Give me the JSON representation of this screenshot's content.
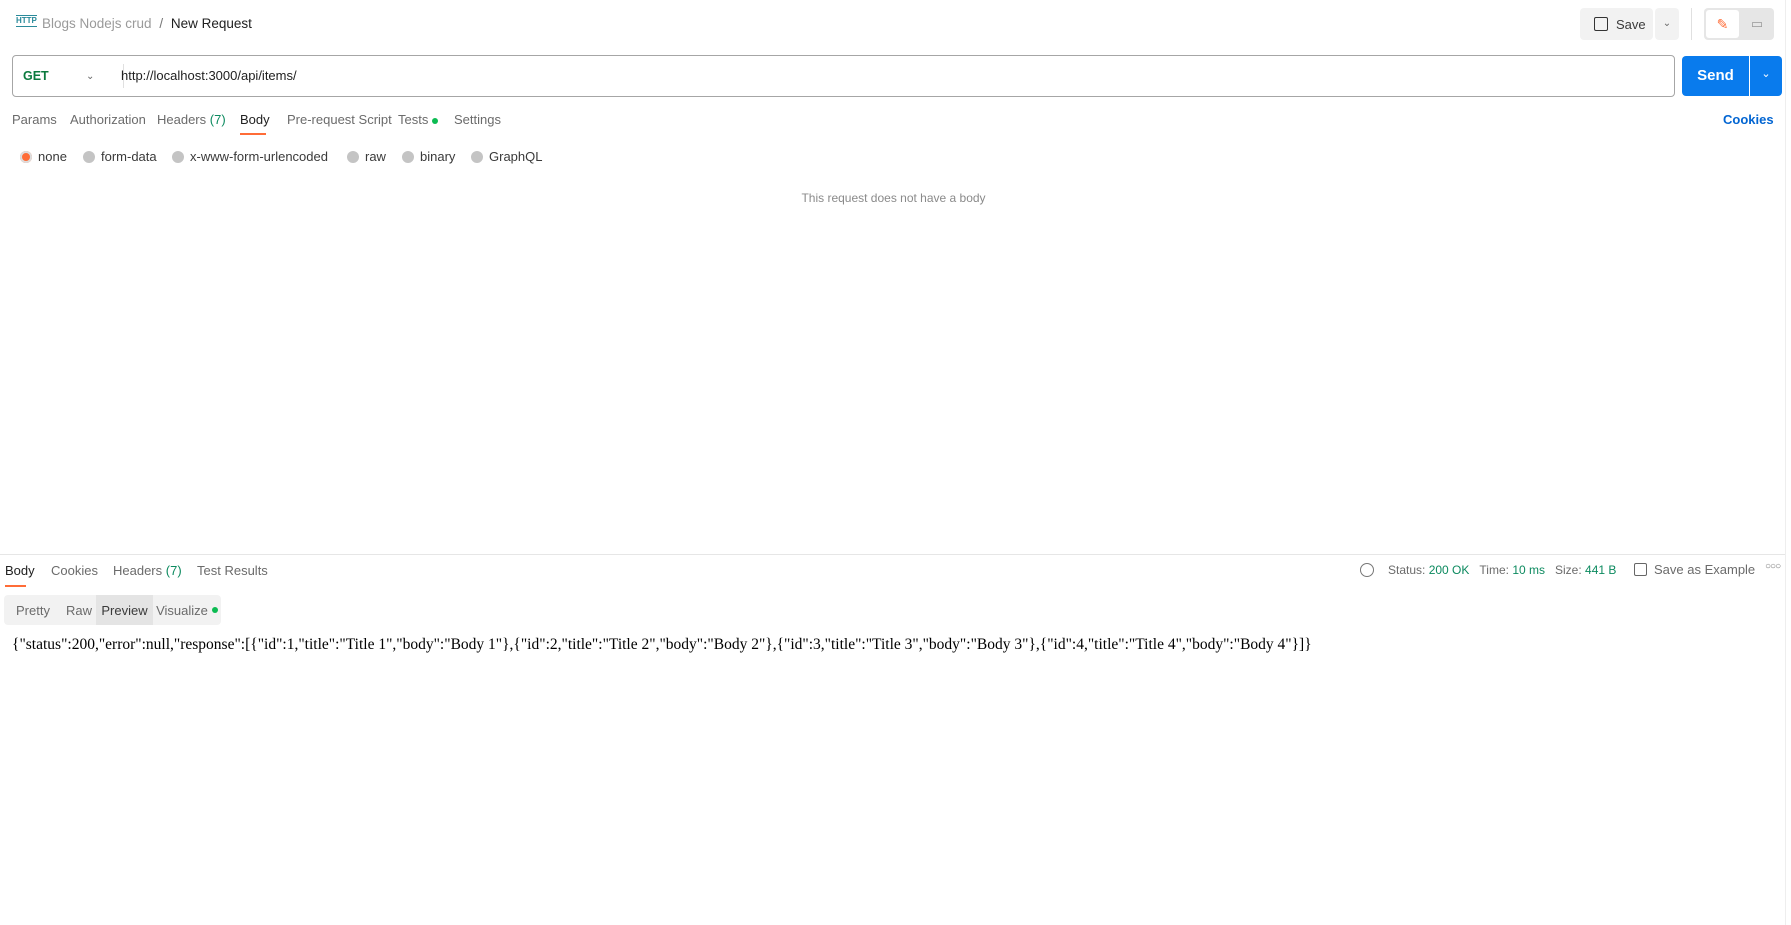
{
  "header": {
    "icon": "http-icon",
    "collection": "Blogs Nodejs crud",
    "separator": "/",
    "request_name": "New Request",
    "save_label": "Save"
  },
  "request": {
    "method": "GET",
    "url": "http://localhost:3000/api/items/",
    "send_label": "Send"
  },
  "tabs": [
    {
      "label": "Params"
    },
    {
      "label": "Authorization"
    },
    {
      "label": "Headers",
      "count": "(7)"
    },
    {
      "label": "Body",
      "active": true
    },
    {
      "label": "Pre-request Script"
    },
    {
      "label": "Tests"
    },
    {
      "label": "Settings"
    }
  ],
  "cookies_label": "Cookies",
  "body_types": [
    {
      "label": "none",
      "selected": true
    },
    {
      "label": "form-data"
    },
    {
      "label": "x-www-form-urlencoded"
    },
    {
      "label": "raw"
    },
    {
      "label": "binary"
    },
    {
      "label": "GraphQL"
    }
  ],
  "empty_body_message": "This request does not have a body",
  "response": {
    "tabs": [
      {
        "label": "Body",
        "active": true
      },
      {
        "label": "Cookies"
      },
      {
        "label": "Headers",
        "count": "(7)"
      },
      {
        "label": "Test Results"
      }
    ],
    "status_label": "Status:",
    "status": "200 OK",
    "time_label": "Time:",
    "time": "10 ms",
    "size_label": "Size:",
    "size": "441 B",
    "save_example_label": "Save as Example",
    "views": [
      {
        "label": "Pretty"
      },
      {
        "label": "Raw"
      },
      {
        "label": "Preview",
        "active": true
      },
      {
        "label": "Visualize"
      }
    ],
    "body": "{\"status\":200,\"error\":null,\"response\":[{\"id\":1,\"title\":\"Title 1\",\"body\":\"Body 1\"},{\"id\":2,\"title\":\"Title 2\",\"body\":\"Body 2\"},{\"id\":3,\"title\":\"Title 3\",\"body\":\"Body 3\"},{\"id\":4,\"title\":\"Title 4\",\"body\":\"Body 4\"}]}"
  },
  "colors": {
    "accent": "#ff6c37",
    "send": "#097bed",
    "link": "#0265d2",
    "success": "#0c8a5f"
  }
}
